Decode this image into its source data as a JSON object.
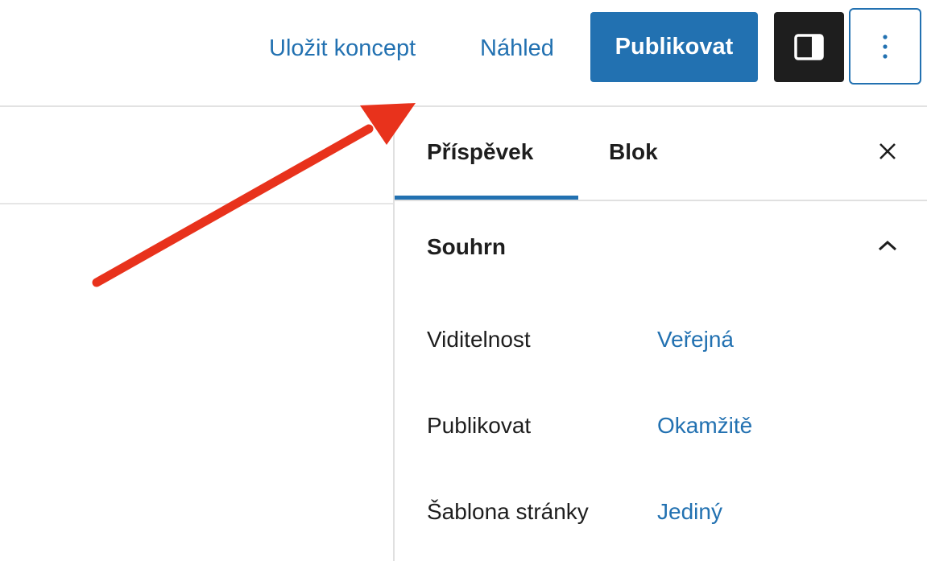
{
  "toolbar": {
    "save_draft_label": "Uložit koncept",
    "preview_label": "Náhled",
    "publish_label": "Publikovat",
    "settings_icon": "sidebar-toggle-icon",
    "options_icon": "more-vertical-icon"
  },
  "sidebar": {
    "tabs": [
      {
        "label": "Příspěvek",
        "active": true
      },
      {
        "label": "Blok",
        "active": false
      }
    ],
    "close_icon": "close-icon",
    "section": {
      "title": "Souhrn",
      "chevron_icon": "chevron-up-icon",
      "rows": [
        {
          "label": "Viditelnost",
          "value": "Veřejná"
        },
        {
          "label": "Publikovat",
          "value": "Okamžitě"
        },
        {
          "label": "Šablona stránky",
          "value": "Jediný"
        }
      ]
    }
  },
  "annotation": {
    "type": "arrow",
    "color": "#e8321c"
  },
  "colors": {
    "accent": "#2271b1",
    "dark": "#1e1e1e"
  }
}
